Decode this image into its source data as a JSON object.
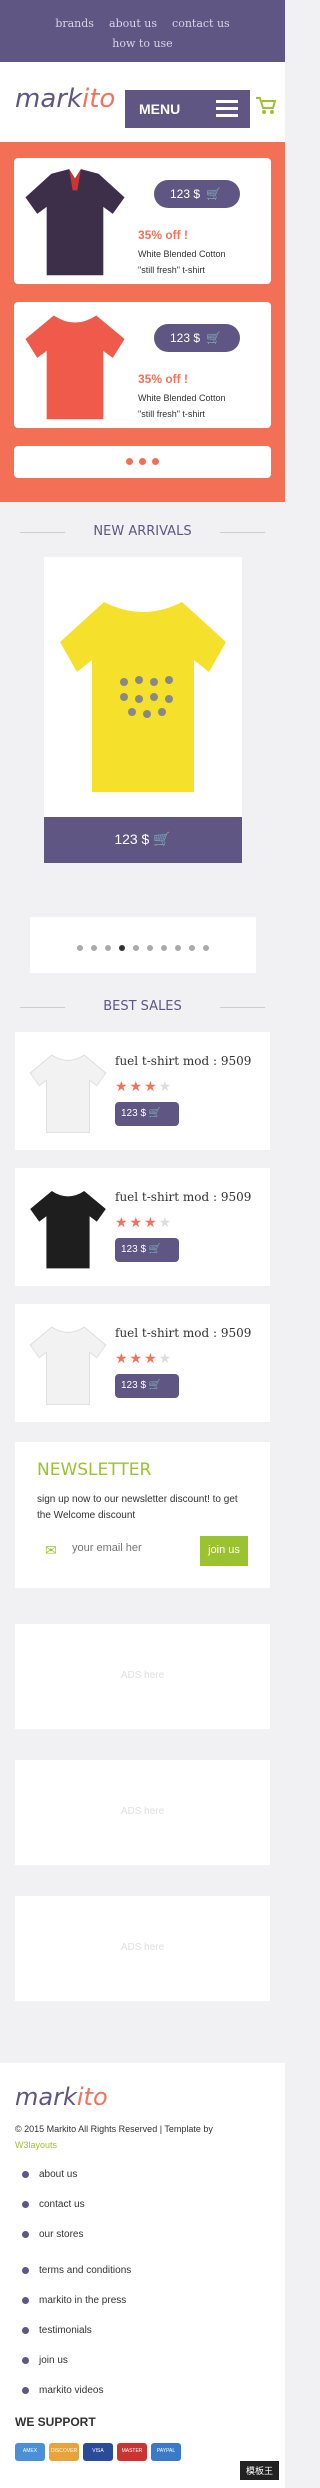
{
  "topnav": {
    "links": [
      "brands",
      "about us",
      "contact us",
      "how to use"
    ]
  },
  "header": {
    "logo_part1": "mark",
    "logo_part2": "ito",
    "menu_label": "MENU"
  },
  "promo": {
    "products": [
      {
        "price": "123 $",
        "discount": "35% off !",
        "desc_line1": "White Blended Cotton",
        "desc_line2": "\"still fresh\" t-shirt",
        "color": "#3d2f4a"
      },
      {
        "price": "123 $",
        "discount": "35% off !",
        "desc_line1": "White Blended Cotton",
        "desc_line2": "\"still fresh\" t-shirt",
        "color": "#ef5a4a"
      }
    ]
  },
  "arrivals": {
    "title": "NEW ARRIVALS",
    "price": "123 $",
    "color": "#f5e02b"
  },
  "best": {
    "title": "BEST SALES",
    "items": [
      {
        "name": "fuel t-shirt mod : 9509",
        "price": "123 $",
        "rating": 3,
        "color": "#f2f2f2"
      },
      {
        "name": "fuel t-shirt mod : 9509",
        "price": "123 $",
        "rating": 3,
        "color": "#1e1e1e"
      },
      {
        "name": "fuel t-shirt mod : 9509",
        "price": "123 $",
        "rating": 3,
        "color": "#f2f2f2"
      }
    ]
  },
  "newsletter": {
    "title": "NEWSLETTER",
    "text": "sign up now to our newsletter discount! to get the Welcome discount",
    "placeholder": "your email her",
    "button": "join us"
  },
  "ads": [
    "ADS here",
    "ADS here",
    "ADS here"
  ],
  "footer": {
    "logo_part1": "mark",
    "logo_part2": "ito",
    "copyright": "© 2015 Markito All Rights Reserved | Template by",
    "author": "W3layouts",
    "links1": [
      "about us",
      "contact us",
      "our stores"
    ],
    "links2": [
      "terms and conditions",
      "markito in the press",
      "testimonials",
      "join us",
      "markito videos"
    ],
    "support": "WE SUPPORT",
    "cards": [
      "AMEX",
      "DISCOVER",
      "VISA",
      "MASTER",
      "PAYPAL"
    ],
    "watermark": "模板王"
  },
  "colors": {
    "purple": "#5f5683",
    "coral": "#f37057",
    "green": "#9bc330"
  }
}
